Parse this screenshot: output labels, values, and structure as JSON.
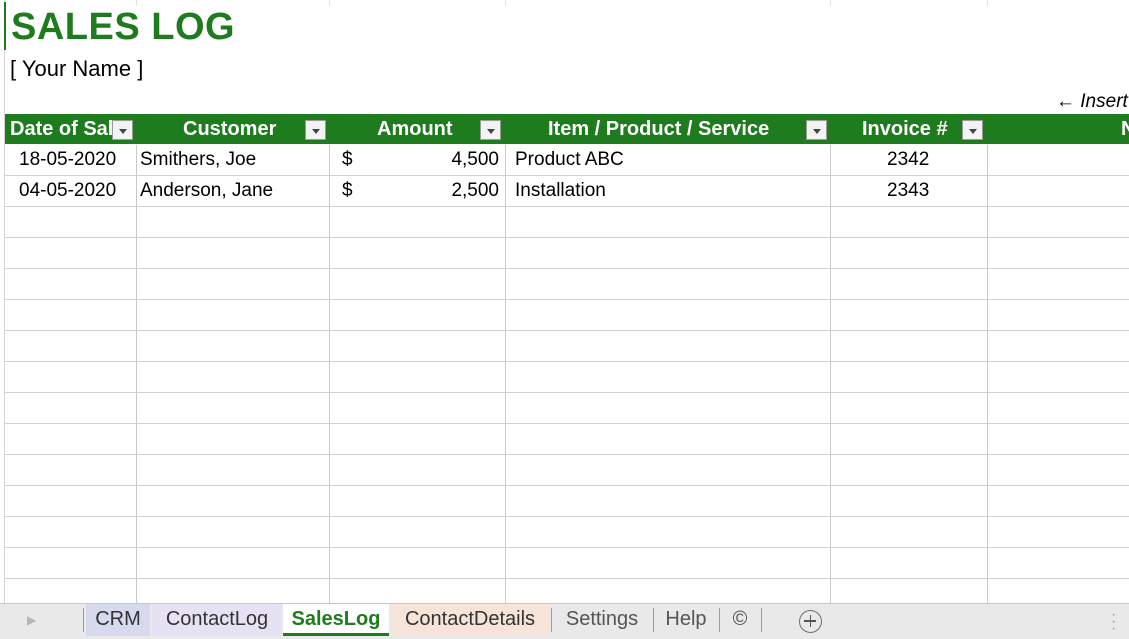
{
  "sheet": {
    "title": "SALES LOG",
    "subtitle": "[ Your Name ]",
    "insert_note": "← Insert"
  },
  "table": {
    "columns": [
      {
        "label": "Date of Sale"
      },
      {
        "label": "Customer"
      },
      {
        "label": "Amount"
      },
      {
        "label": "Item / Product / Service"
      },
      {
        "label": "Invoice #"
      },
      {
        "label": "Notes"
      }
    ],
    "rows": [
      {
        "date": "18-05-2020",
        "customer": "Smithers, Joe",
        "currency": "$",
        "amount": "4,500",
        "item": "Product ABC",
        "invoice": "2342"
      },
      {
        "date": "04-05-2020",
        "customer": "Anderson, Jane",
        "currency": "$",
        "amount": "2,500",
        "item": "Installation",
        "invoice": "2343"
      }
    ]
  },
  "tabs": {
    "items": [
      "CRM",
      "ContactLog",
      "SalesLog",
      "ContactDetails",
      "Settings",
      "Help",
      "©"
    ],
    "active": "SalesLog",
    "prev_glyph": "▶"
  },
  "colors": {
    "accent": "#1e7b1e",
    "header_text": "#ffffff",
    "crm_tab": "#d7d9ef",
    "contactlog_tab": "#e6e2f3",
    "contactdetails_tab": "#f6e4d8"
  },
  "icons": {
    "filter": "chevron-down-icon",
    "add_sheet": "plus-circle-icon",
    "more": "vertical-dots-icon"
  }
}
